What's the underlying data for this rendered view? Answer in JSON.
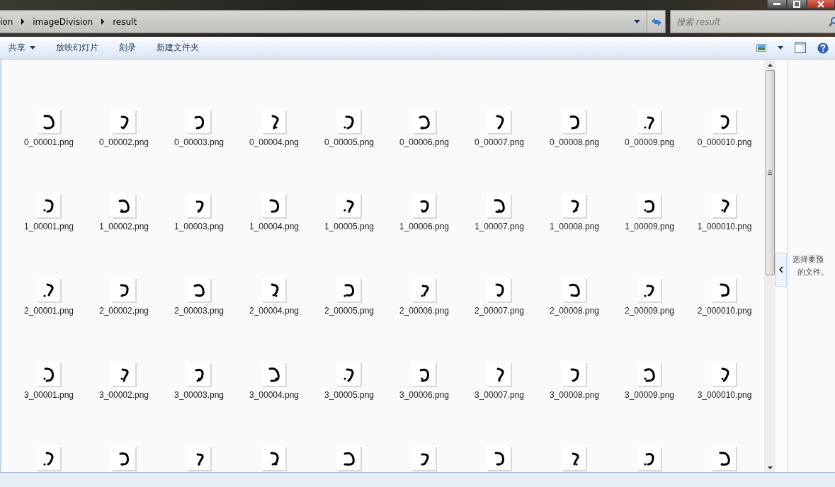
{
  "address_bar": {
    "crumbs": [
      "ion",
      "imageDivision",
      "result"
    ]
  },
  "search": {
    "placeholder": "搜索 result"
  },
  "toolbar": {
    "items": [
      {
        "label": "共享",
        "kind": "menu"
      },
      {
        "label": "放映幻灯片",
        "kind": "button"
      },
      {
        "label": "刻录",
        "kind": "button"
      },
      {
        "label": "新建文件夹",
        "kind": "button"
      }
    ]
  },
  "files": [
    [
      {
        "kind": "picture",
        "name": "0_00001.png"
      },
      {
        "kind": "picture",
        "name": "0_00002.png"
      },
      {
        "kind": "picture",
        "name": "0_00003.png"
      },
      {
        "kind": "picture",
        "name": "0_00004.png"
      },
      {
        "kind": "picture",
        "name": "0_00005.png"
      },
      {
        "kind": "picture",
        "name": "0_00006.png"
      },
      {
        "kind": "picture",
        "name": "0_00007.png"
      },
      {
        "kind": "picture",
        "name": "0_00008.png"
      },
      {
        "kind": "picture",
        "name": "0_00009.png"
      },
      {
        "kind": "picture",
        "name": "0_000010.png"
      }
    ],
    [
      {
        "kind": "picture",
        "name": "1_00001.png"
      },
      {
        "kind": "picture",
        "name": "1_00002.png"
      },
      {
        "kind": "picture",
        "name": "1_00003.png"
      },
      {
        "kind": "picture",
        "name": "1_00004.png"
      },
      {
        "kind": "picture",
        "name": "1_00005.png"
      },
      {
        "kind": "picture",
        "name": "1_00006.png"
      },
      {
        "kind": "picture",
        "name": "1_00007.png"
      },
      {
        "kind": "picture",
        "name": "1_00008.png"
      },
      {
        "kind": "picture",
        "name": "1_00009.png"
      },
      {
        "kind": "picture",
        "name": "1_000010.png"
      }
    ],
    [
      {
        "kind": "picture",
        "name": "2_00001.png"
      },
      {
        "kind": "picture",
        "name": "2_00002.png"
      },
      {
        "kind": "picture",
        "name": "2_00003.png"
      },
      {
        "kind": "picture",
        "name": "2_00004.png"
      },
      {
        "kind": "picture",
        "name": "2_00005.png"
      },
      {
        "kind": "picture",
        "name": "2_00006.png"
      },
      {
        "kind": "picture",
        "name": "2_00007.png"
      },
      {
        "kind": "picture",
        "name": "2_00008.png"
      },
      {
        "kind": "picture",
        "name": "2_00009.png"
      },
      {
        "kind": "picture",
        "name": "2_000010.png"
      }
    ],
    [
      {
        "kind": "picture",
        "name": "3_00001.png"
      },
      {
        "kind": "picture",
        "name": "3_00002.png"
      },
      {
        "kind": "picture",
        "name": "3_00003.png"
      },
      {
        "kind": "picture",
        "name": "3_00004.png"
      },
      {
        "kind": "picture",
        "name": "3_00005.png"
      },
      {
        "kind": "picture",
        "name": "3_00006.png"
      },
      {
        "kind": "picture",
        "name": "3_00007.png"
      },
      {
        "kind": "picture",
        "name": "3_00008.png"
      },
      {
        "kind": "picture",
        "name": "3_00009.png"
      },
      {
        "kind": "picture",
        "name": "3_000010.png"
      }
    ],
    [
      {
        "kind": "picture"
      },
      {
        "kind": "picture"
      },
      {
        "kind": "picture"
      },
      {
        "kind": "picture"
      },
      {
        "kind": "picture"
      },
      {
        "kind": "picture"
      },
      {
        "kind": "picture"
      },
      {
        "kind": "picture"
      },
      {
        "kind": "picture"
      },
      {
        "kind": "picture"
      }
    ]
  ],
  "preview_pane": {
    "lines": [
      "选择要预",
      "的文件。"
    ]
  }
}
